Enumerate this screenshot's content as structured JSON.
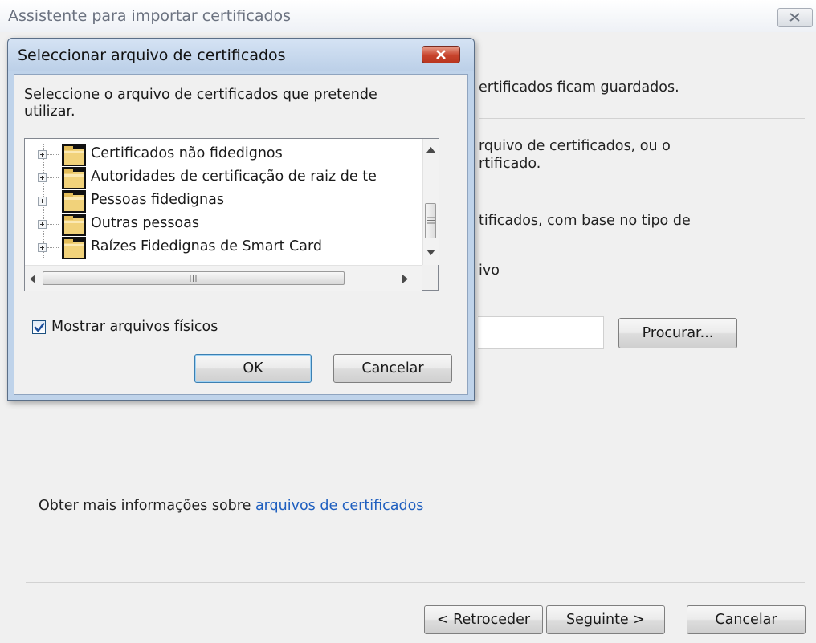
{
  "wizard": {
    "title": "Assistente para importar certificados",
    "text_fragments": {
      "store_info": "ertificados ficam guardados.",
      "choose_line1": "rquivo de certificados, ou o",
      "choose_line2": "rtificado.",
      "auto_select": "tificados, com base no tipo de",
      "place_file": "ivo"
    },
    "browse_label": "Procurar...",
    "more_info_text": "Obter mais informações sobre",
    "more_info_link": "arquivos de certificados",
    "back_label": "< Retroceder",
    "next_label": "Seguinte >",
    "cancel_label": "Cancelar"
  },
  "dialog": {
    "title": "Seleccionar arquivo de certificados",
    "prompt": "Seleccione o arquivo de certificados que pretende utilizar.",
    "tree_items": [
      "Certificados não fidedignos",
      "Autoridades de certificação de raiz de te",
      "Pessoas fidedignas",
      "Outras pessoas",
      "Raízes Fidedignas de Smart Card"
    ],
    "show_physical_label": "Mostrar arquivos físicos",
    "show_physical_checked": true,
    "ok_label": "OK",
    "cancel_label": "Cancelar"
  },
  "icons": {
    "close": "close-icon",
    "folder": "folder-icon",
    "expand": "plus-expander-icon",
    "scroll_up": "arrow-up-icon",
    "scroll_down": "arrow-down-icon",
    "scroll_left": "arrow-left-icon",
    "scroll_right": "arrow-right-icon",
    "check": "checkmark-icon"
  },
  "colors": {
    "dialog_frame": "#bfd3ea",
    "close_button_red": "#c7432c",
    "link": "#1f5fbf",
    "check": "#1c4f9c"
  }
}
